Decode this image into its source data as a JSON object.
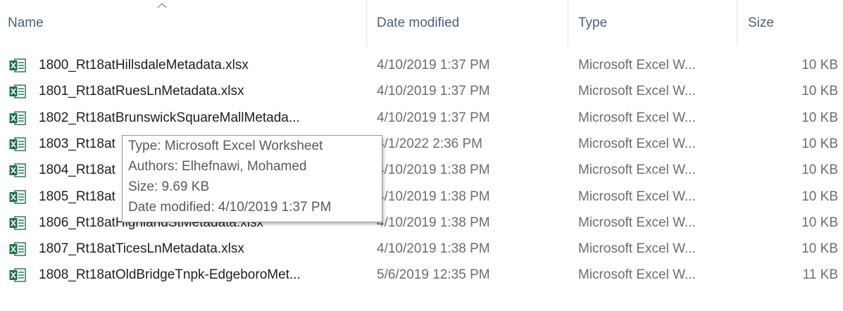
{
  "columns": {
    "name": "Name",
    "date_modified": "Date modified",
    "type": "Type",
    "size": "Size"
  },
  "sort": {
    "column": "Name",
    "direction": "ascending",
    "icon": "chevron-up-icon"
  },
  "files": [
    {
      "name": "1800_Rt18atHillsdaleMetadata.xlsx",
      "date": "4/10/2019 1:37 PM",
      "type": "Microsoft Excel W...",
      "size": "10 KB",
      "icon": "excel-file-icon"
    },
    {
      "name": "1801_Rt18atRuesLnMetadata.xlsx",
      "date": "4/10/2019 1:37 PM",
      "type": "Microsoft Excel W...",
      "size": "10 KB",
      "icon": "excel-file-icon"
    },
    {
      "name": "1802_Rt18atBrunswickSquareMallMetada...",
      "date": "4/10/2019 1:37 PM",
      "type": "Microsoft Excel W...",
      "size": "10 KB",
      "icon": "excel-file-icon"
    },
    {
      "name": "1803_Rt18at",
      "date": "4/1/2022 2:36 PM",
      "type": "Microsoft Excel W...",
      "size": "10 KB",
      "icon": "excel-file-icon"
    },
    {
      "name": "1804_Rt18at",
      "date": "4/10/2019 1:38 PM",
      "type": "Microsoft Excel W...",
      "size": "10 KB",
      "icon": "excel-file-icon"
    },
    {
      "name": "1805_Rt18at",
      "date": "4/10/2019 1:38 PM",
      "type": "Microsoft Excel W...",
      "size": "10 KB",
      "icon": "excel-file-icon"
    },
    {
      "name": "1806_Rt18atHighlandStMetadata.xlsx",
      "date": "4/10/2019 1:38 PM",
      "type": "Microsoft Excel W...",
      "size": "10 KB",
      "icon": "excel-file-icon"
    },
    {
      "name": "1807_Rt18atTicesLnMetadata.xlsx",
      "date": "4/10/2019 1:38 PM",
      "type": "Microsoft Excel W...",
      "size": "10 KB",
      "icon": "excel-file-icon"
    },
    {
      "name": "1808_Rt18atOldBridgeTnpk-EdgeboroMet...",
      "date": "5/6/2019 12:35 PM",
      "type": "Microsoft Excel W...",
      "size": "11 KB",
      "icon": "excel-file-icon"
    }
  ],
  "tooltip": {
    "lines": [
      "Type: Microsoft Excel Worksheet",
      "Authors: Elhefnawi, Mohamed",
      "Size: 9.69 KB",
      "Date modified: 4/10/2019 1:37 PM"
    ]
  },
  "colors": {
    "header_text": "#4c607a",
    "secondary_text": "#6d6d6d",
    "excel_green": "#1e7145"
  }
}
